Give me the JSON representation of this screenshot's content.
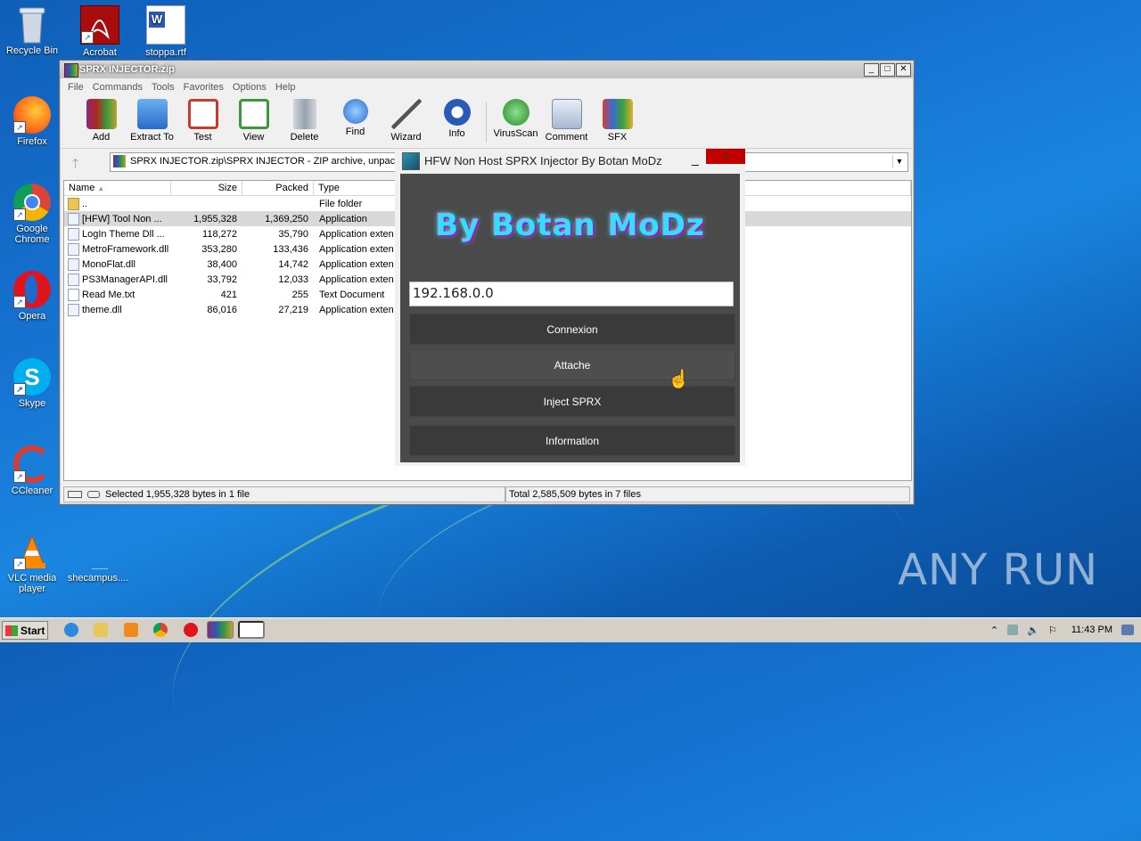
{
  "desktop": {
    "icons": [
      {
        "label": "Recycle Bin",
        "icon": "recycle-bin-icon"
      },
      {
        "label": "Acrobat",
        "icon": "acrobat-icon"
      },
      {
        "label": "stoppa.rtf",
        "icon": "word-document-icon"
      },
      {
        "label": "Firefox",
        "icon": "firefox-icon"
      },
      {
        "label": "Google Chrome",
        "icon": "chrome-icon"
      },
      {
        "label": "Opera",
        "icon": "opera-icon"
      },
      {
        "label": "Skype",
        "icon": "skype-icon"
      },
      {
        "label": "CCleaner",
        "icon": "ccleaner-icon"
      },
      {
        "label": "VLC media player",
        "icon": "vlc-icon"
      },
      {
        "label": "shecampus....",
        "icon": "blank-file-icon"
      }
    ],
    "watermark": "ANY RUN"
  },
  "winrar": {
    "title": "SPRX INJECTOR.zip",
    "menu": [
      "File",
      "Commands",
      "Tools",
      "Favorites",
      "Options",
      "Help"
    ],
    "toolbar": [
      {
        "label": "Add",
        "icon": "add-archive-icon",
        "color": "#b0281e"
      },
      {
        "label": "Extract To",
        "icon": "extract-folder-icon",
        "color": "#3a8ae0"
      },
      {
        "label": "Test",
        "icon": "test-clipboard-icon",
        "color": "#c83a2a"
      },
      {
        "label": "View",
        "icon": "view-book-icon",
        "color": "#3a9a3a"
      },
      {
        "label": "Delete",
        "icon": "delete-trash-icon",
        "color": "#9aa3ad"
      },
      {
        "label": "Find",
        "icon": "find-magnifier-icon",
        "color": "#2a6ad0"
      },
      {
        "label": "Wizard",
        "icon": "wizard-wand-icon",
        "color": "#e0e0e0"
      },
      {
        "label": "Info",
        "icon": "info-icon",
        "color": "#2a5ab8"
      },
      {
        "label": "VirusScan",
        "icon": "virus-scan-icon",
        "color": "#3aa03a"
      },
      {
        "label": "Comment",
        "icon": "comment-icon",
        "color": "#8a9aba"
      },
      {
        "label": "SFX",
        "icon": "sfx-box-icon",
        "color": "#d0403a"
      }
    ],
    "address": "SPRX INJECTOR.zip\\SPRX INJECTOR - ZIP archive, unpacked",
    "columns": [
      "Name",
      "Size",
      "Packed",
      "Type"
    ],
    "files": [
      {
        "name": "..",
        "size": "",
        "packed": "",
        "type": "File folder",
        "folder": true
      },
      {
        "name": "[HFW] Tool Non ...",
        "size": "1,955,328",
        "packed": "1,369,250",
        "type": "Application",
        "selected": true
      },
      {
        "name": "LogIn Theme Dll ...",
        "size": "118,272",
        "packed": "35,790",
        "type": "Application extens"
      },
      {
        "name": "MetroFramework.dll",
        "size": "353,280",
        "packed": "133,436",
        "type": "Application extens"
      },
      {
        "name": "MonoFlat.dll",
        "size": "38,400",
        "packed": "14,742",
        "type": "Application extens"
      },
      {
        "name": "PS3ManagerAPI.dll",
        "size": "33,792",
        "packed": "12,033",
        "type": "Application extens"
      },
      {
        "name": "Read Me.txt",
        "size": "421",
        "packed": "255",
        "type": "Text Document"
      },
      {
        "name": "theme.dll",
        "size": "86,016",
        "packed": "27,219",
        "type": "Application extens"
      }
    ],
    "status_left": "Selected 1,955,328 bytes in 1 file",
    "status_right": "Total 2,585,509 bytes in 7 files"
  },
  "injector": {
    "title": "HFW Non Host SPRX Injector By Botan MoDz",
    "minimize": "_",
    "close": "x",
    "logo": "By Botan MoDz",
    "ip_value": "192.168.0.0",
    "buttons": [
      "Connexion",
      "Attache",
      "Inject SPRX",
      "Information"
    ]
  },
  "taskbar": {
    "start": "Start",
    "time": "11:43 PM"
  }
}
